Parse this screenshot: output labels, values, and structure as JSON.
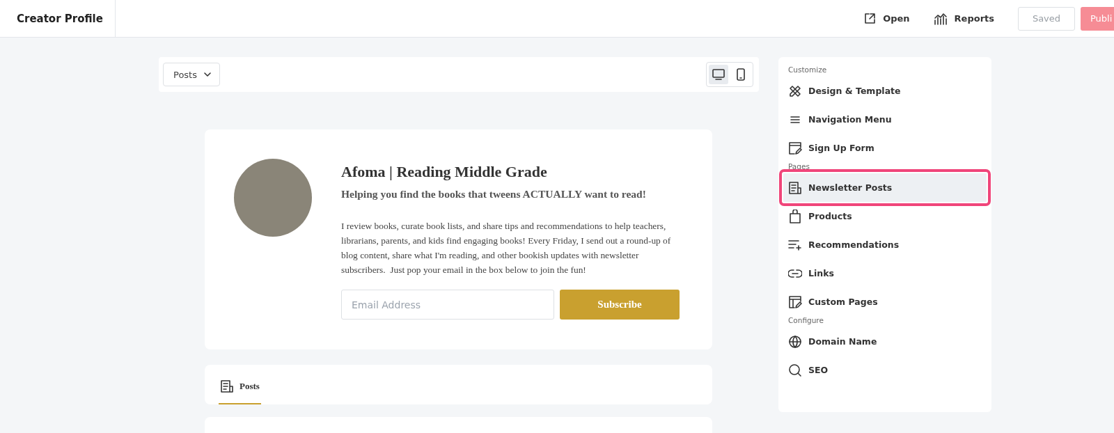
{
  "header": {
    "title": "Creator Profile",
    "actions": [
      {
        "label": "Open",
        "kind": "open"
      },
      {
        "label": "Reports",
        "kind": "reports"
      }
    ],
    "saved_button": {
      "label": "Saved",
      "disabled": true
    },
    "publish_button": {
      "label": "Publi"
    }
  },
  "toolbar": {
    "dropdown": "Posts",
    "devices": [
      {
        "kind": "desktop",
        "selected": true
      },
      {
        "kind": "mobile",
        "selected": false
      }
    ]
  },
  "profile": {
    "name": "Afoma | Reading Middle Grade",
    "tagline": "Helping you find the books that tweens ACTUALLY want to read!",
    "bio": "I review books, curate book lists, and share tips and recommendations to help teachers, librarians, parents, and kids find engaging books! Every Friday, I send out a round-up of blog content, share what I'm reading, and other bookish updates with newsletter subscribers.  Just pop your email in the box below to join the fun!",
    "email_placeholder": "Email Address",
    "subscribe": "Subscribe"
  },
  "posts_tab": {
    "label": "Posts",
    "selected": true
  },
  "sidebar": {
    "sections": [
      {
        "heading": "Customize",
        "items": [
          {
            "label": "Design & Template",
            "kind": "design",
            "selected": false
          },
          {
            "label": "Navigation Menu",
            "kind": "menu",
            "selected": false
          },
          {
            "label": "Sign Up Form",
            "kind": "form",
            "selected": false
          }
        ]
      },
      {
        "heading": "Pages",
        "items": [
          {
            "label": "Newsletter Posts",
            "kind": "posts",
            "selected": true
          },
          {
            "label": "Products",
            "kind": "bag",
            "selected": false
          },
          {
            "label": "Recommendations",
            "kind": "recs",
            "selected": false
          },
          {
            "label": "Links",
            "kind": "link",
            "selected": false
          },
          {
            "label": "Custom Pages",
            "kind": "pages",
            "selected": false
          }
        ]
      },
      {
        "heading": "Configure",
        "items": [
          {
            "label": "Domain Name",
            "kind": "globe",
            "selected": false
          },
          {
            "label": "SEO",
            "kind": "search",
            "selected": false
          }
        ]
      }
    ]
  }
}
